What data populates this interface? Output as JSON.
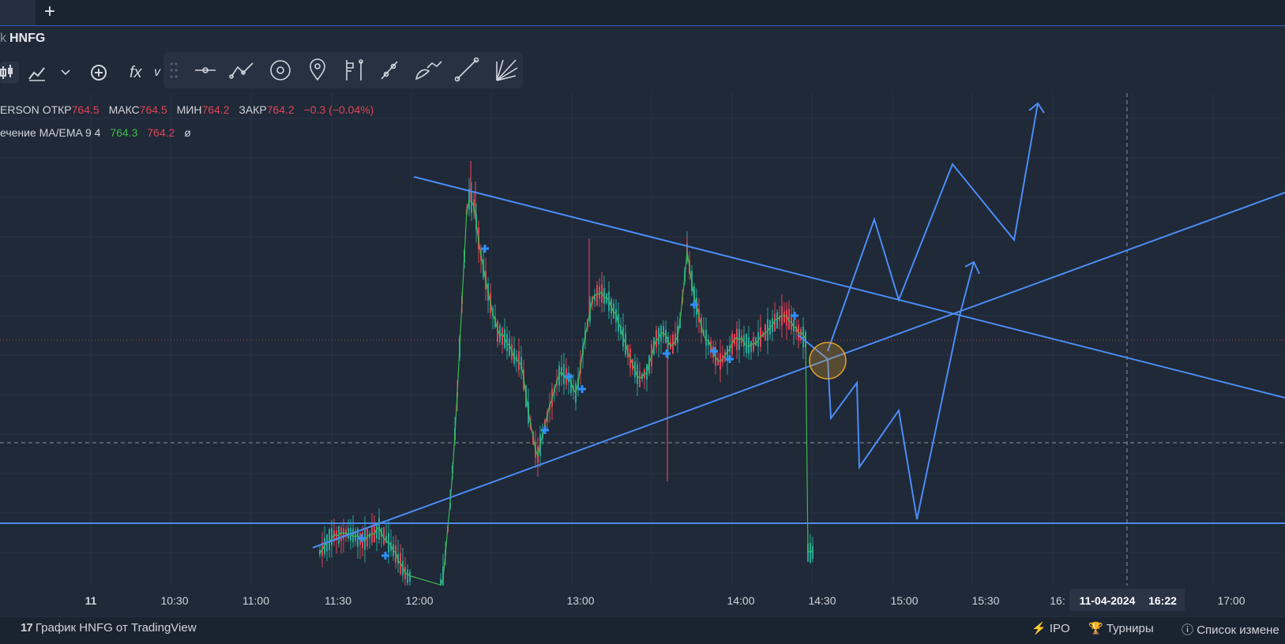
{
  "tabs": {
    "new_tab": "+"
  },
  "symbol": {
    "prefix": "k",
    "name": "HNFG"
  },
  "legend": {
    "name": "ERSON",
    "open_label": "ОТКР",
    "open_value": "764.5",
    "high_label": "МАКС",
    "high_value": "764.5",
    "low_label": "МИН",
    "low_value": "764.2",
    "close_label": "ЗАКР",
    "close_value": "764.2",
    "change": "−0.3 (−0.04%)"
  },
  "indicator": {
    "name": "ечение MA/EMA 9 4",
    "value1": "764.3",
    "value2": "764.2",
    "value3": "ø"
  },
  "toolbar": {
    "fx_label": "fx",
    "extra": "v"
  },
  "chart_data": {
    "type": "candlestick",
    "x_tick_labels": [
      "11",
      "10:30",
      "11:00",
      "11:30",
      "12:00",
      "13:00",
      "14:00",
      "14:30",
      "15:00",
      "15:30",
      "16:",
      "17:00"
    ],
    "crosshair_date_label": "11-04-2024",
    "crosshair_time_label": "16:22",
    "last_price": 764.2,
    "colors": {
      "up": "#26a69a",
      "down": "#e04357",
      "drawing": "#4c8cf5",
      "ma": "#3fb950",
      "marker": "#2f8fff"
    },
    "drawings": [
      "descending trendline",
      "ascending trendline",
      "horizontal support line",
      "projected zigzag path",
      "highlight circle"
    ]
  },
  "footer": {
    "brand_text": "График HNFG от TradingView",
    "ipo": "IPO",
    "tournaments": "Турниры",
    "list": "Список измене"
  }
}
